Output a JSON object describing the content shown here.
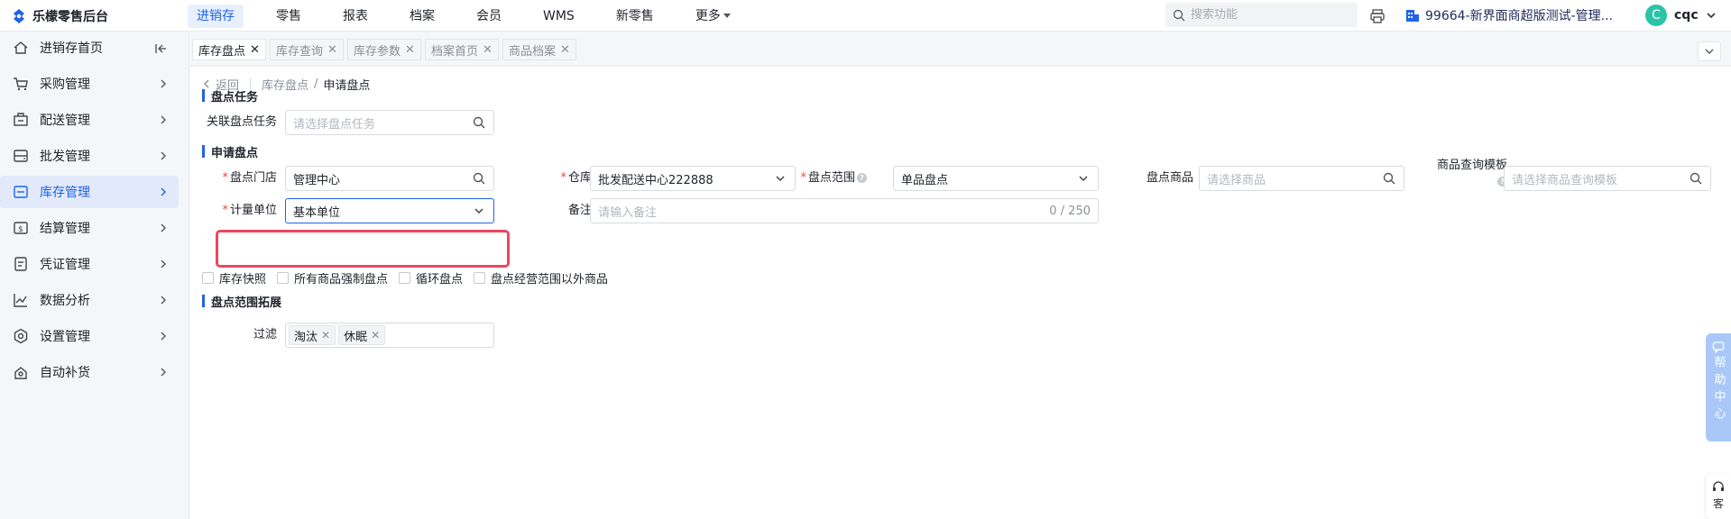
{
  "app": {
    "title": "乐檬零售后台"
  },
  "topnav": {
    "items": [
      "进销存",
      "零售",
      "报表",
      "档案",
      "会员",
      "WMS",
      "新零售"
    ],
    "more_label": "更多"
  },
  "header": {
    "search_placeholder": "搜索功能",
    "store_name": "99664-新界面商超版测试-管理...",
    "avatar_letter": "C",
    "user_name": "cqc"
  },
  "sidebar": {
    "items": [
      {
        "label": "进销存首页",
        "icon": "home-icon"
      },
      {
        "label": "采购管理",
        "icon": "cart-icon"
      },
      {
        "label": "配送管理",
        "icon": "delivery-icon"
      },
      {
        "label": "批发管理",
        "icon": "wholesale-icon"
      },
      {
        "label": "库存管理",
        "icon": "inventory-icon"
      },
      {
        "label": "结算管理",
        "icon": "settlement-icon"
      },
      {
        "label": "凭证管理",
        "icon": "voucher-icon"
      },
      {
        "label": "数据分析",
        "icon": "chart-icon"
      },
      {
        "label": "设置管理",
        "icon": "settings-icon"
      },
      {
        "label": "自动补货",
        "icon": "replenish-icon"
      }
    ],
    "active_item": "库存管理"
  },
  "tabs": [
    "库存盘点",
    "库存查询",
    "库存参数",
    "档案首页",
    "商品档案"
  ],
  "breadcrumb": {
    "back": "返回",
    "parent": "库存盘点",
    "separator": "/",
    "current": "申请盘点"
  },
  "task_section": {
    "title": "盘点任务",
    "task_label": "关联盘点任务",
    "task_placeholder": "请选择盘点任务"
  },
  "apply_section": {
    "title": "申请盘点",
    "store_label": "盘点门店",
    "store_value": "管理中心",
    "warehouse_label": "仓库",
    "warehouse_value": "批发配送中心222888",
    "scope_label": "盘点范围",
    "scope_value": "单品盘点",
    "product_label": "盘点商品",
    "product_placeholder": "请选择商品",
    "template_label": "商品查询模板",
    "template_placeholder": "请选择商品查询模板",
    "unit_label": "计量单位",
    "unit_value": "基本单位",
    "remark_label": "备注",
    "remark_placeholder": "请输入备注",
    "remark_count": "0 / 250",
    "required_mark": "*"
  },
  "checkboxes": [
    "库存快照",
    "所有商品强制盘点",
    "循环盘点",
    "盘点经营范围以外商品"
  ],
  "expand_section": {
    "title": "盘点范围拓展",
    "filter_label": "过滤",
    "filter_tags": [
      "淘汰",
      "休眠"
    ]
  },
  "float": {
    "help_center": "帮助中心",
    "service": "客"
  },
  "colors": {
    "accent": "#1f63e8",
    "highlight": "#e8485e",
    "required": "#f04343"
  }
}
